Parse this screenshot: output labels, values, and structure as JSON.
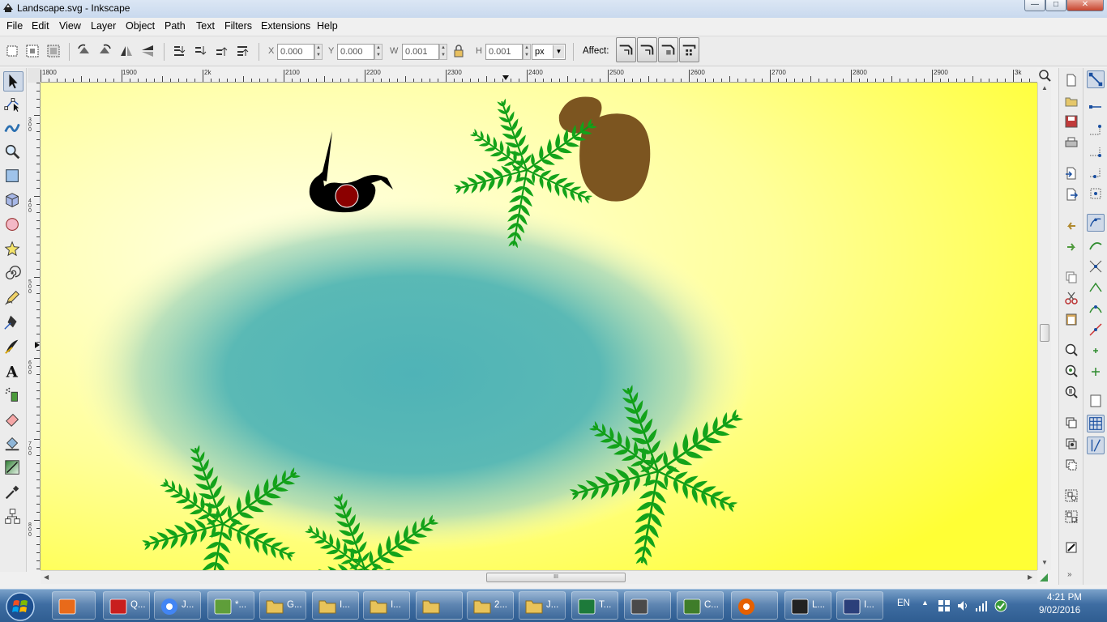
{
  "window": {
    "title": "Landscape.svg - Inkscape"
  },
  "window_buttons": {
    "minimize": "—",
    "maximize": "□",
    "close": "✕"
  },
  "menu": [
    "File",
    "Edit",
    "View",
    "Layer",
    "Object",
    "Path",
    "Text",
    "Filters",
    "Extensions",
    "Help"
  ],
  "toolbar": {
    "x_label": "X",
    "x_value": "0.000",
    "y_label": "Y",
    "y_value": "0.000",
    "w_label": "W",
    "w_value": "0.001",
    "h_label": "H",
    "h_value": "0.001",
    "unit": "px",
    "affect_label": "Affect:"
  },
  "ruler_top_labels": [
    "1800",
    "1900",
    "2k",
    "2100",
    "2200",
    "2300",
    "2400",
    "2500",
    "2600",
    "2700",
    "2800",
    "2900",
    "3k"
  ],
  "ruler_left_labels": [
    "300",
    "400",
    "500",
    "600",
    "700",
    "800"
  ],
  "hscroll_grip": "III",
  "taskbar": {
    "items": [
      {
        "label": "",
        "icon": "media-player-icon"
      },
      {
        "label": "Q...",
        "icon": "app-icon"
      },
      {
        "label": "J...",
        "icon": "chrome-icon"
      },
      {
        "label": "*...",
        "icon": "notepad-icon"
      },
      {
        "label": "G...",
        "icon": "folder-icon"
      },
      {
        "label": "I...",
        "icon": "folder-icon"
      },
      {
        "label": "I...",
        "icon": "folder-icon"
      },
      {
        "label": "",
        "icon": "folder-icon"
      },
      {
        "label": "2...",
        "icon": "folder-icon"
      },
      {
        "label": "J...",
        "icon": "folder-icon"
      },
      {
        "label": "T...",
        "icon": "excel-icon"
      },
      {
        "label": "",
        "icon": "monitor-icon"
      },
      {
        "label": "C...",
        "icon": "tree-icon"
      },
      {
        "label": "",
        "icon": "firefox-icon"
      },
      {
        "label": "L...",
        "icon": "inkscape-icon"
      },
      {
        "label": "I...",
        "icon": "editor-icon"
      }
    ],
    "language": "EN",
    "time": "4:21 PM",
    "date": "9/02/2016"
  }
}
